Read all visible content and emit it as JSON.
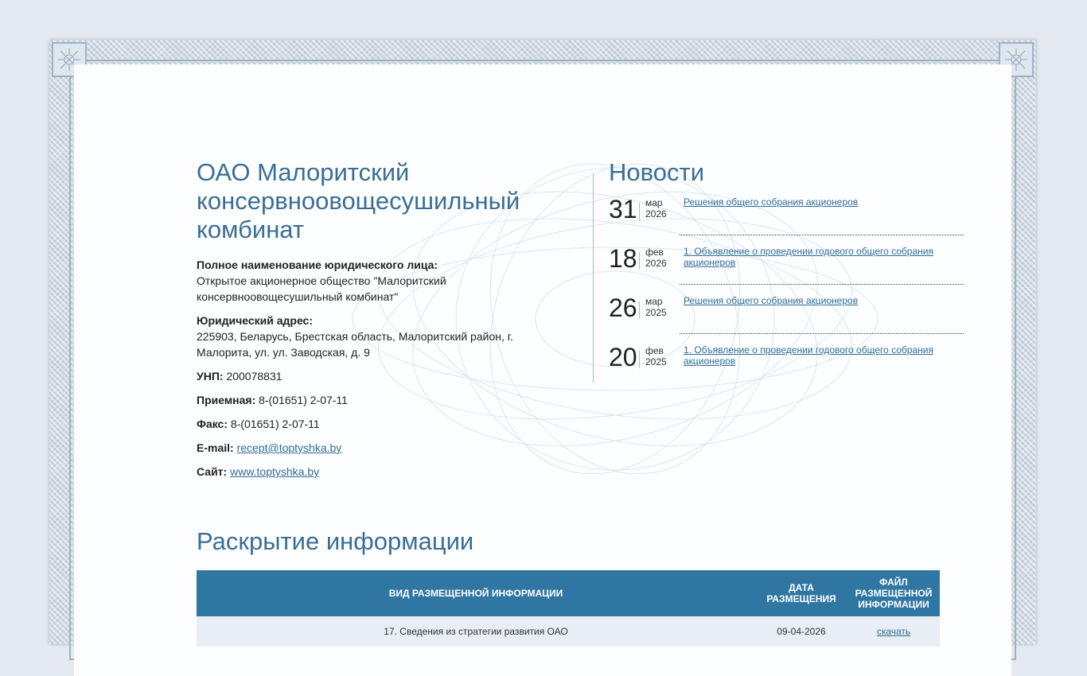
{
  "company": {
    "title": "ОАО Малоритский консервноовощесушильный комбинат",
    "full_name_label": "Полное наименование юридического лица:",
    "full_name_value": "Открытое акционерное общество \"Малоритский консервноовощесушильный комбинат\"",
    "address_label": "Юридический адрес:",
    "address_value": "225903, Беларусь, Брестская область, Малоритский район, г. Малорита, ул. ул. Заводская, д. 9",
    "unp_label": "УНП:",
    "unp_value": "200078831",
    "reception_label": "Приемная:",
    "reception_value": "8-(01651) 2-07-11",
    "fax_label": "Факс:",
    "fax_value": "8-(01651) 2-07-11",
    "email_label": "E-mail:",
    "email_value": "recept@toptyshka.by",
    "site_label": "Сайт:",
    "site_value": "www.toptyshka.by"
  },
  "news": {
    "title": "Новости",
    "items": [
      {
        "day": "31",
        "month": "мар",
        "year": "2026",
        "text": "Решения общего собрания акционеров"
      },
      {
        "day": "18",
        "month": "фев",
        "year": "2026",
        "text": "1. Объявление о проведении годового общего собрания акционеров"
      },
      {
        "day": "26",
        "month": "мар",
        "year": "2025",
        "text": "Решения общего собрания акционеров"
      },
      {
        "day": "20",
        "month": "фев",
        "year": "2025",
        "text": "1. Объявление о проведении годового общего собрания акционеров"
      }
    ]
  },
  "disclosure": {
    "title": "Раскрытие информации",
    "headers": [
      "Вид размещенной информации",
      "Дата размещения",
      "Файл размещенной информации"
    ],
    "rows": [
      {
        "type": "17. Сведения из стратегии развития ОАО",
        "date": "09-04-2026",
        "file": "скачать"
      }
    ]
  },
  "colors": {
    "accent": "#3a6e95",
    "table_header": "#2f77a2",
    "link": "#2e6d95",
    "background": "#e4eaf0"
  }
}
